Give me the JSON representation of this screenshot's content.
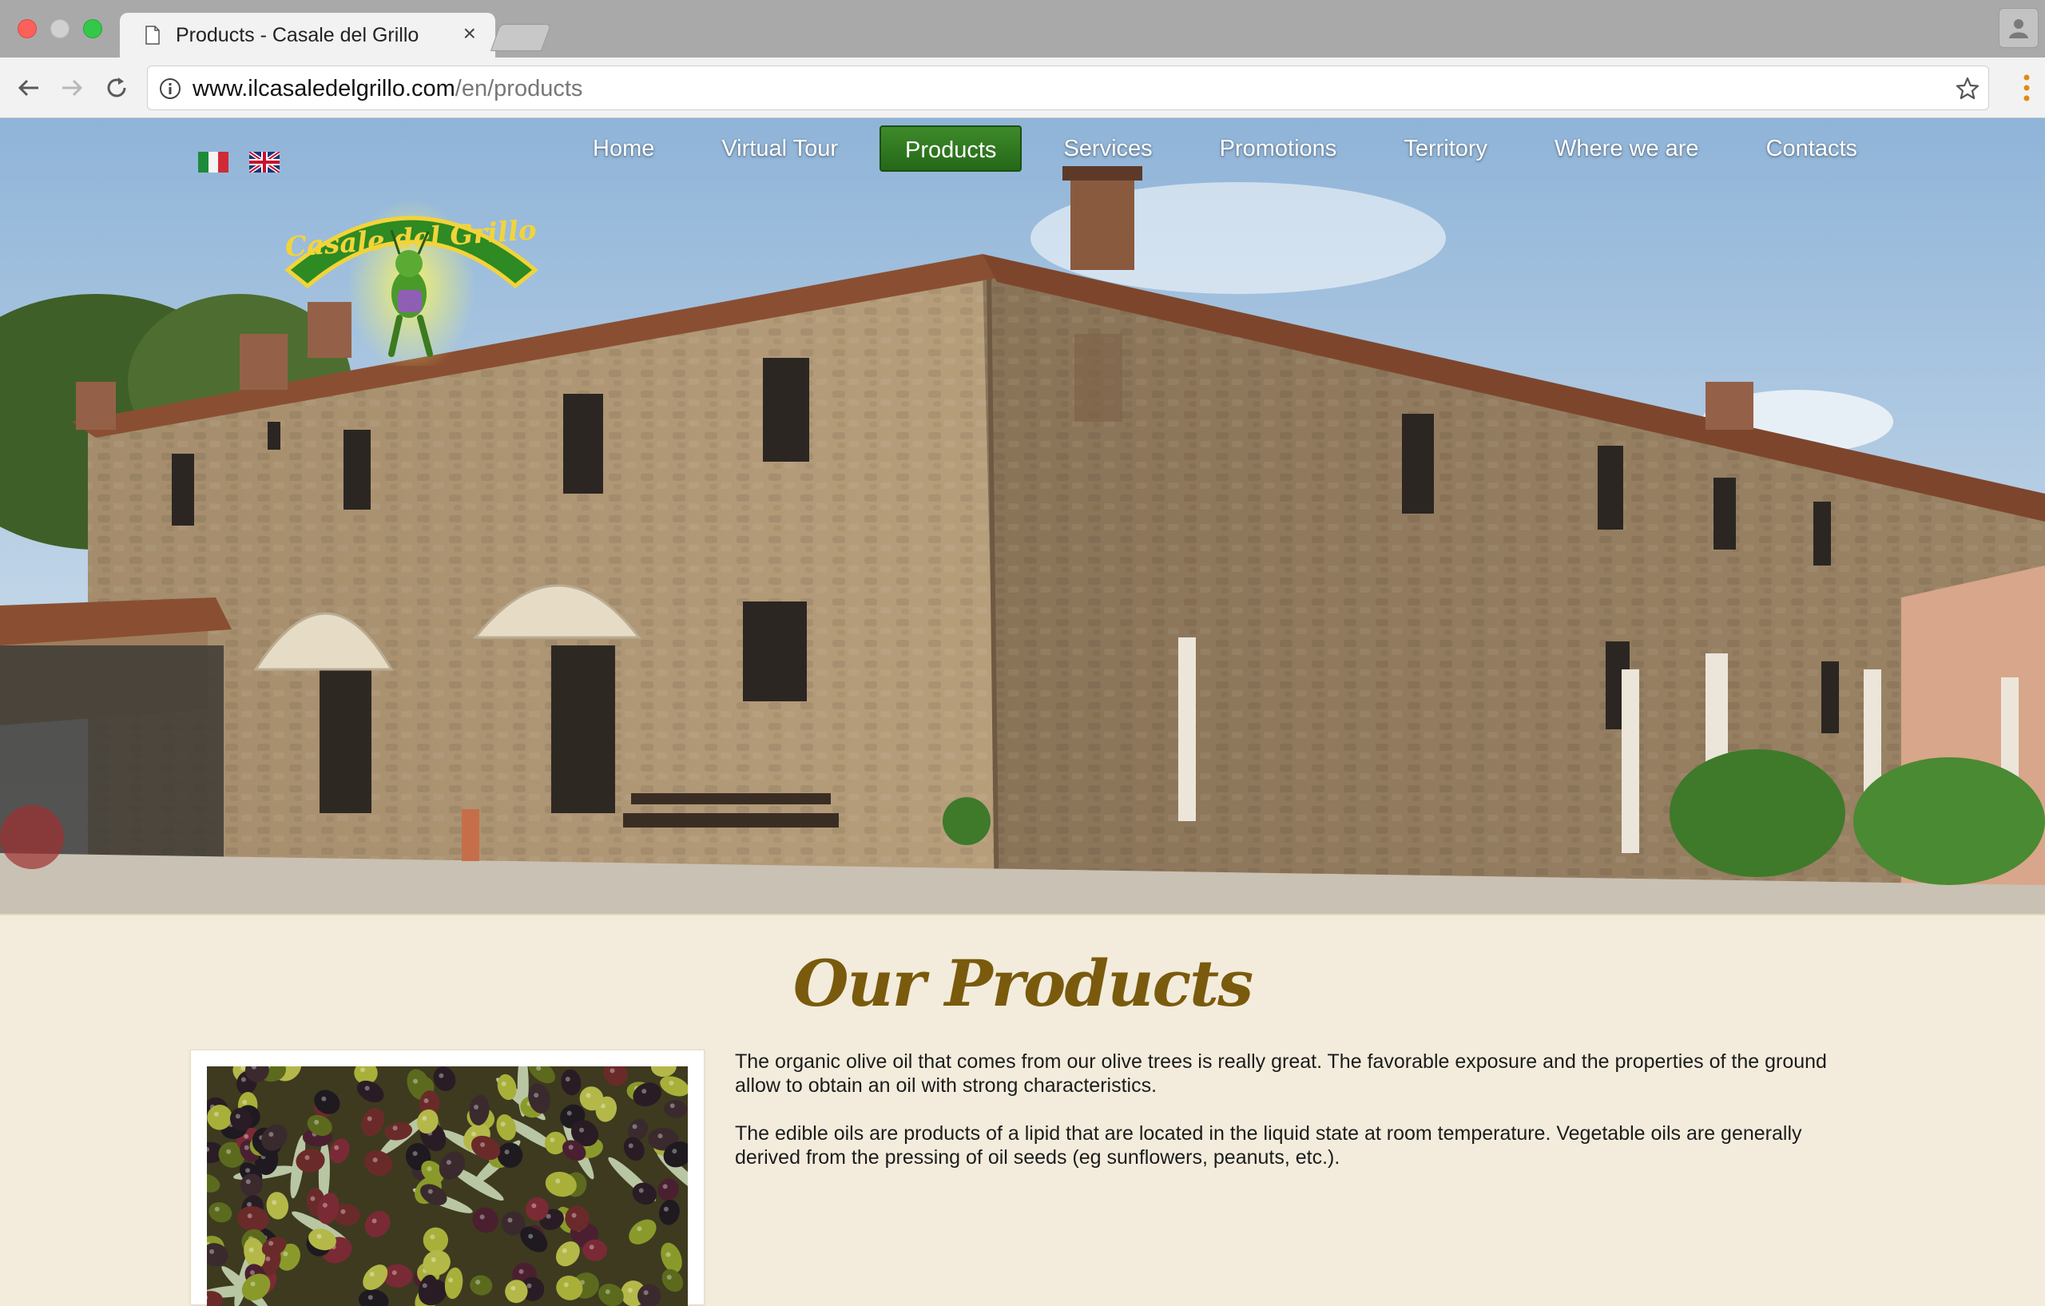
{
  "browser": {
    "tab_title": "Products - Casale del Grillo",
    "tab_close": "×",
    "url_host": "www.ilcasaledelgrillo.com",
    "url_path": "/en/products"
  },
  "site": {
    "logo_text": "Casale del Grillo",
    "languages": [
      "it",
      "en"
    ],
    "nav": [
      "Home",
      "Virtual Tour",
      "Products",
      "Services",
      "Promotions",
      "Territory",
      "Where we are",
      "Contacts"
    ],
    "active_nav": "Products",
    "heading": "Our Products",
    "paragraphs": [
      "The organic olive oil that comes from our olive trees is really great. The favorable exposure and the properties of the ground allow to obtain an oil with strong characteristics.",
      "The edible oils are products of a lipid that are located in the liquid state at room temperature. Vegetable oils are generally derived from the pressing of oil seeds (eg sunflowers, peanuts, etc.)."
    ]
  },
  "colors": {
    "accent_green": "#2f7a1f",
    "heading_brown": "#7a5a0c",
    "page_bg": "#f3ecdc"
  }
}
